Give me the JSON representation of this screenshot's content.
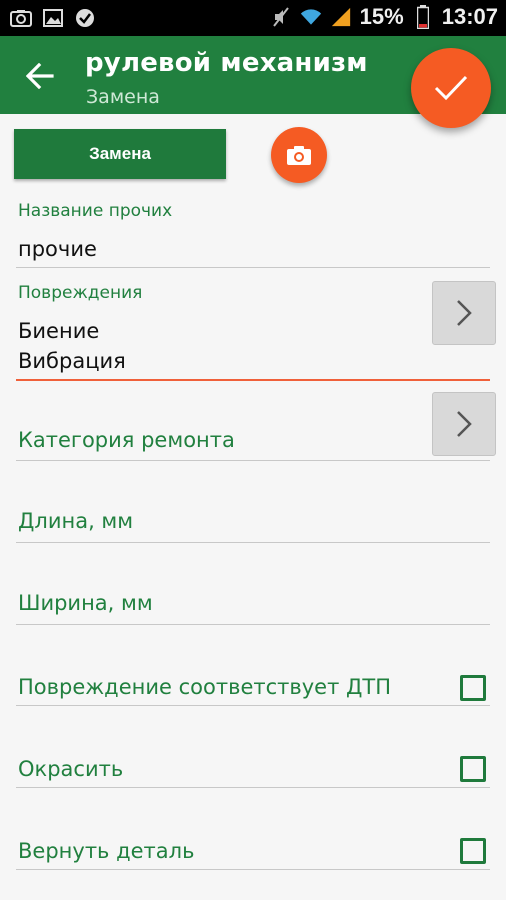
{
  "status_bar": {
    "battery": "15%",
    "time": "13:07"
  },
  "app_bar": {
    "title": "рулевой механизм",
    "subtitle": "Замена"
  },
  "actions": {
    "replace_label": "Замена"
  },
  "fields": {
    "other_name": {
      "label": "Название прочих",
      "value": "прочие"
    },
    "damages": {
      "label": "Повреждения",
      "values": [
        "Биение",
        "Вибрация"
      ]
    },
    "repair_category": {
      "hint": "Категория ремонта"
    },
    "length": {
      "hint": "Длина, мм"
    },
    "width": {
      "hint": "Ширина, мм"
    }
  },
  "checkboxes": [
    {
      "label": "Повреждение соответствует ДТП",
      "checked": false
    },
    {
      "label": "Окрасить",
      "checked": false
    },
    {
      "label": "Вернуть деталь",
      "checked": false
    }
  ],
  "colors": {
    "primary": "#21803f",
    "accent": "#f55b23",
    "focus_underline": "#f0603a"
  }
}
